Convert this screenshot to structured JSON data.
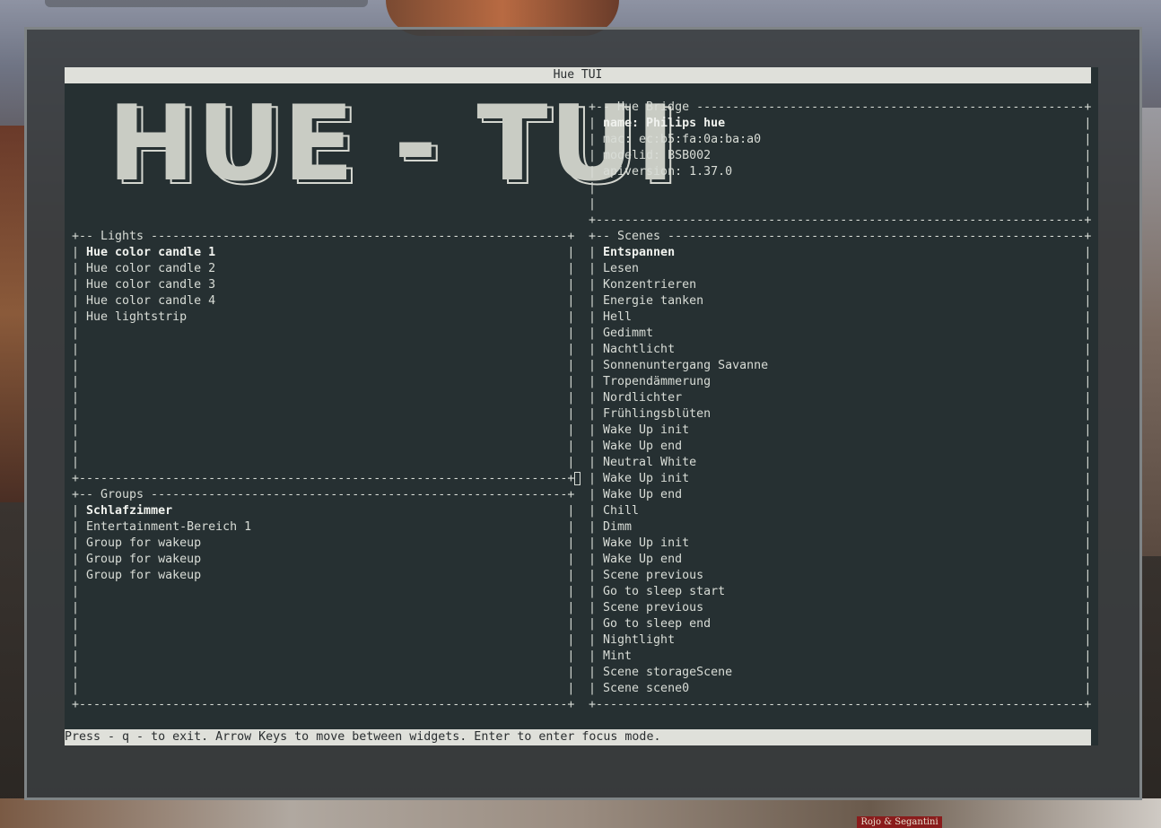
{
  "app": {
    "title": "Hue TUI",
    "logo_text": "HUE - TUI",
    "status_bar": "Press - q - to exit. Arrow Keys to move between widgets. Enter to enter focus mode."
  },
  "bridge": {
    "header": "Hue Bridge",
    "name_label": "name: Philips hue",
    "mac": "mac: ec:b5:fa:0a:ba:a0",
    "modelid": "modelid: BSB002",
    "apiversion": "apiversion: 1.37.0"
  },
  "lights": {
    "header": "Lights",
    "items": [
      "Hue color candle 1",
      "Hue color candle 2",
      "Hue color candle 3",
      "Hue color candle 4",
      "Hue lightstrip"
    ]
  },
  "groups": {
    "header": "Groups",
    "items": [
      "Schlafzimmer",
      "Entertainment-Bereich 1",
      "Group for wakeup",
      "Group for wakeup",
      "Group for wakeup"
    ]
  },
  "scenes": {
    "header": "Scenes",
    "items": [
      "Entspannen",
      "Lesen",
      "Konzentrieren",
      "Energie tanken",
      "Hell",
      "Gedimmt",
      "Nachtlicht",
      "Sonnenuntergang Savanne",
      "Tropendämmerung",
      "Nordlichter",
      "Frühlingsblüten",
      "Wake Up init",
      "Wake Up end",
      "Neutral White",
      "Wake Up init",
      "Wake Up end",
      "Chill",
      "Dimm",
      "Wake Up init",
      "Wake Up end",
      "Scene previous",
      "Go to sleep start",
      "Scene previous",
      "Go to sleep end",
      "Nightlight",
      "Mint",
      "Scene storageScene",
      "Scene scene0"
    ]
  },
  "background": {
    "sign_text": "Rojo & Segantini"
  }
}
